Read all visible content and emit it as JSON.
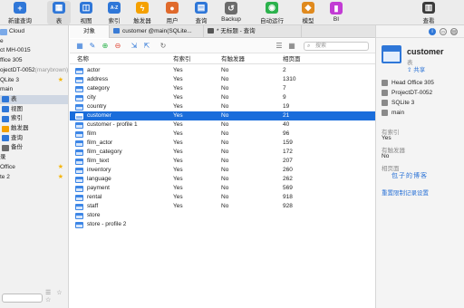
{
  "toolbar": {
    "buttons": [
      {
        "label": "新建查询",
        "icon": "new-query-icon",
        "color": "#2f77d8",
        "glyph": "+"
      },
      {
        "label": "表",
        "icon": "table-icon",
        "color": "#2f77d8",
        "glyph": "▦"
      },
      {
        "label": "视图",
        "icon": "view-icon",
        "color": "#2f77d8",
        "glyph": "◫"
      },
      {
        "label": "索引",
        "icon": "index-icon",
        "color": "#2f77d8",
        "glyph": "A-Z"
      },
      {
        "label": "触发器",
        "icon": "trigger-icon",
        "color": "#f5a100",
        "glyph": "ϟ"
      },
      {
        "label": "用户",
        "icon": "user-icon",
        "color": "#e06a2c",
        "glyph": "●"
      },
      {
        "label": "查询",
        "icon": "query-icon",
        "color": "#2f77d8",
        "glyph": "▤"
      },
      {
        "label": "Backup",
        "icon": "backup-icon",
        "color": "#6b6b6b",
        "glyph": "↺"
      },
      {
        "label": "自动运行",
        "icon": "automation-icon",
        "color": "#2bb24c",
        "glyph": "◉"
      },
      {
        "label": "模型",
        "icon": "model-icon",
        "color": "#e08a1e",
        "glyph": "◆"
      },
      {
        "label": "BI",
        "icon": "bi-icon",
        "color": "#c23bd4",
        "glyph": "▮"
      },
      {
        "label": "查看",
        "icon": "view-toggle-icon",
        "color": "#3b3b3b",
        "glyph": "▥"
      }
    ]
  },
  "sidebar": {
    "rows": [
      {
        "text": "Cloud",
        "star": false,
        "icon": "cloud-icon",
        "color": ""
      },
      {
        "text": "e",
        "star": false,
        "icon": "",
        "color": ""
      },
      {
        "text": "ct MH-0015",
        "star": false,
        "icon": "",
        "color": ""
      },
      {
        "text": "ffice 305",
        "star": false,
        "icon": "",
        "color": ""
      },
      {
        "text": "ojectDT-0052 ",
        "muted": "(marybrown)",
        "star": false,
        "icon": "",
        "color": ""
      },
      {
        "text": "QLite 3",
        "star": true,
        "icon": "",
        "color": ""
      },
      {
        "text": "main",
        "star": false,
        "icon": "",
        "color": ""
      },
      {
        "text": "表",
        "star": false,
        "icon": "table-icon",
        "color": "#2f77d8",
        "selected": true
      },
      {
        "text": "视图",
        "star": false,
        "icon": "view-icon",
        "color": "#2f77d8"
      },
      {
        "text": "索引",
        "star": false,
        "icon": "index-icon",
        "color": "#2f77d8",
        "prefix": "A-Z"
      },
      {
        "text": "触发器",
        "star": false,
        "icon": "trigger-icon",
        "color": "#f5a100"
      },
      {
        "text": "查询",
        "star": false,
        "icon": "query-icon",
        "color": "#2f77d8"
      },
      {
        "text": "备份",
        "star": false,
        "icon": "backup-icon",
        "color": "#6b6b6b"
      },
      {
        "text": "录",
        "star": false,
        "icon": "",
        "color": ""
      },
      {
        "text": "Office",
        "star": true,
        "icon": "",
        "color": ""
      },
      {
        "text": "te 2",
        "star": true,
        "icon": "",
        "color": ""
      }
    ],
    "tools": "☰ ☆ ☆"
  },
  "tabs": [
    {
      "label": "对象",
      "active": true,
      "icon": ""
    },
    {
      "label": "customer @main(SQLite...",
      "active": false,
      "icon": "table"
    },
    {
      "label": "* 无标题 - 查询",
      "active": false,
      "icon": "query"
    }
  ],
  "objbar": {
    "search_placeholder": "搜索"
  },
  "table": {
    "headers": [
      "名称",
      "有索引",
      "有触发器",
      "相页面"
    ],
    "rows": [
      {
        "name": "actor",
        "idx": "Yes",
        "trg": "No",
        "pages": "2"
      },
      {
        "name": "address",
        "idx": "Yes",
        "trg": "No",
        "pages": "1310"
      },
      {
        "name": "category",
        "idx": "Yes",
        "trg": "No",
        "pages": "7"
      },
      {
        "name": "city",
        "idx": "Yes",
        "trg": "No",
        "pages": "9"
      },
      {
        "name": "country",
        "idx": "Yes",
        "trg": "No",
        "pages": "19"
      },
      {
        "name": "customer",
        "idx": "Yes",
        "trg": "No",
        "pages": "21",
        "selected": true
      },
      {
        "name": "customer - profile 1",
        "idx": "Yes",
        "trg": "No",
        "pages": "40"
      },
      {
        "name": "film",
        "idx": "Yes",
        "trg": "No",
        "pages": "96"
      },
      {
        "name": "film_actor",
        "idx": "Yes",
        "trg": "No",
        "pages": "159"
      },
      {
        "name": "film_category",
        "idx": "Yes",
        "trg": "No",
        "pages": "172"
      },
      {
        "name": "film_text",
        "idx": "Yes",
        "trg": "No",
        "pages": "207"
      },
      {
        "name": "inventory",
        "idx": "Yes",
        "trg": "No",
        "pages": "260"
      },
      {
        "name": "language",
        "idx": "Yes",
        "trg": "No",
        "pages": "262"
      },
      {
        "name": "payment",
        "idx": "Yes",
        "trg": "No",
        "pages": "569"
      },
      {
        "name": "rental",
        "idx": "Yes",
        "trg": "No",
        "pages": "918"
      },
      {
        "name": "staff",
        "idx": "Yes",
        "trg": "No",
        "pages": "928"
      },
      {
        "name": "store",
        "idx": "",
        "trg": "",
        "pages": ""
      },
      {
        "name": "store - profile 2",
        "idx": "",
        "trg": "",
        "pages": ""
      }
    ]
  },
  "rpanel": {
    "name": "customer",
    "type": "表",
    "share": "共享",
    "lines": [
      "Head Office 305",
      "ProjectDT-0052",
      "SQLite 3",
      "main"
    ],
    "has_index_label": "有索引",
    "has_index_value": "Yes",
    "has_trigger_label": "有触发器",
    "has_trigger_value": "No",
    "pages_label": "相页面",
    "reset_link": "重置限制记录设置",
    "watermark": "包子的博客"
  }
}
